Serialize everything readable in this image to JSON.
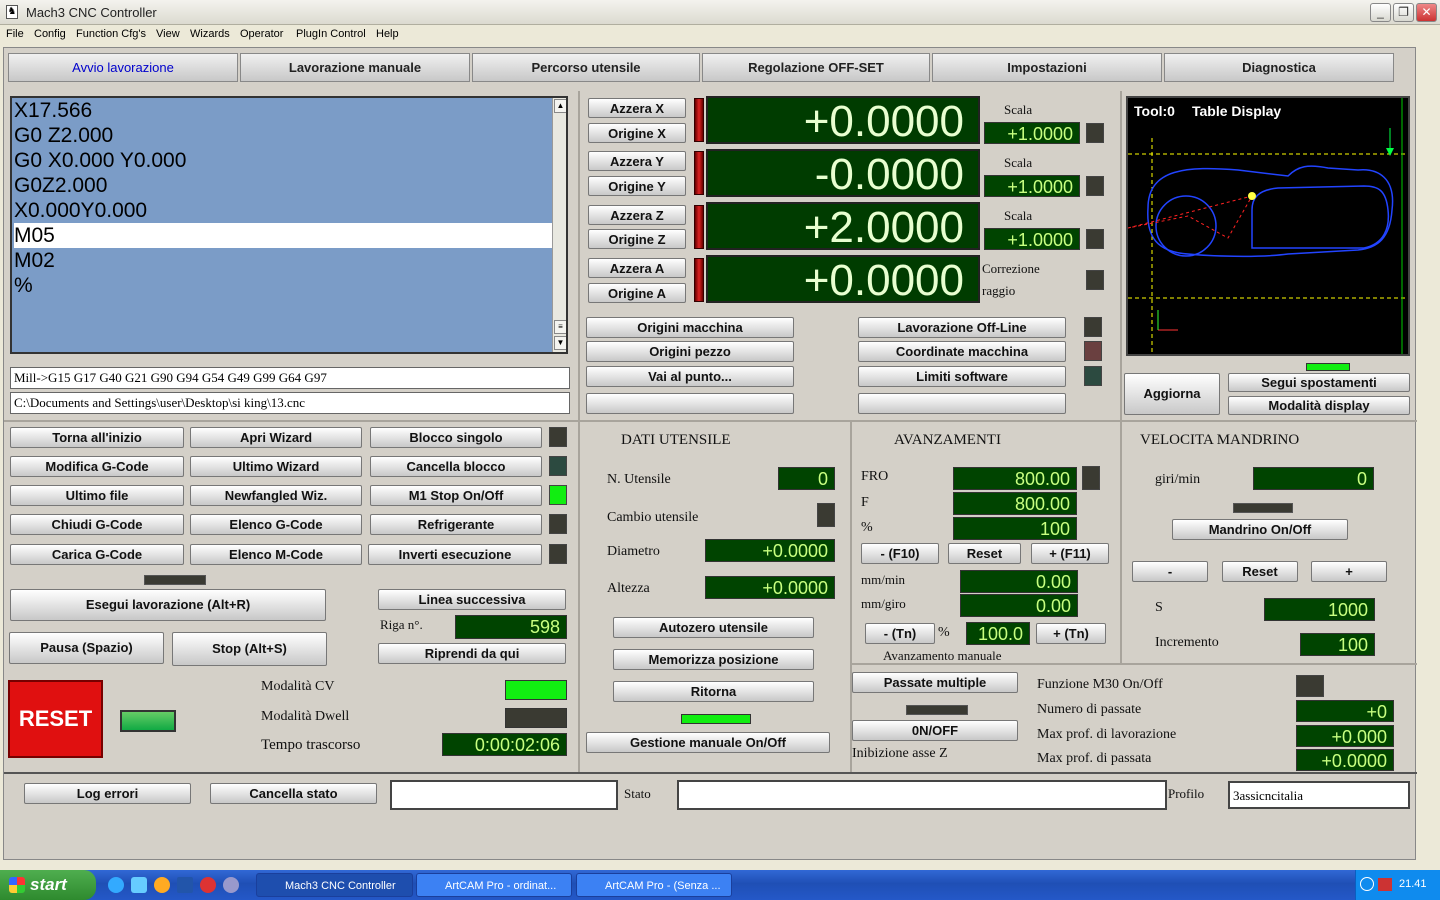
{
  "window": {
    "title": "Mach3 CNC Controller"
  },
  "menu": [
    "File",
    "Config",
    "Function Cfg's",
    "View",
    "Wizards",
    "Operator",
    "PlugIn Control",
    "Help"
  ],
  "tabs": [
    "Avvio lavorazione",
    "Lavorazione manuale",
    "Percorso utensile",
    "Regolazione OFF-SET",
    "Impostazioni",
    "Diagnostica"
  ],
  "gcode": {
    "lines": [
      "X17.566",
      "G0   Z2.000",
      "G0 X0.000 Y0.000",
      "G0Z2.000",
      "X0.000Y0.000",
      "M05",
      "M02",
      "%"
    ]
  },
  "modal_line": "Mill->G15  G17 G40 G21 G90 G94 G54 G49 G99 G64 G97",
  "file_path": "C:\\Documents and Settings\\user\\Desktop\\si king\\13.cnc",
  "axes": [
    {
      "zero": "Azzera X",
      "ref": "Origine X",
      "value": "+0.0000",
      "scale_label": "Scala",
      "scale": "+1.0000"
    },
    {
      "zero": "Azzera Y",
      "ref": "Origine Y",
      "value": "-0.0000",
      "scale_label": "Scala",
      "scale": "+1.0000"
    },
    {
      "zero": "Azzera Z",
      "ref": "Origine Z",
      "value": "+2.0000",
      "scale_label": "Scala",
      "scale": "+1.0000"
    },
    {
      "zero": "Azzera A",
      "ref": "Origine A",
      "value": "+0.0000"
    }
  ],
  "radius_comp": {
    "line1": "Correzione",
    "line2": "raggio"
  },
  "coord_buttons": {
    "machine_origins": "Origini macchina",
    "part_origins": "Origini pezzo",
    "goto": "Vai al punto...",
    "offline": "Lavorazione Off-Line",
    "machine_coords": "Coordinate macchina",
    "soft_limits": "Limiti software"
  },
  "toolpath": {
    "tool": "Tool:0",
    "title": "Table Display",
    "refresh": "Aggiorna",
    "follow": "Segui spostamenti",
    "display_mode": "Modalità display"
  },
  "left_buttons": [
    [
      "Torna all'inizio",
      "Apri Wizard",
      "Blocco singolo"
    ],
    [
      "Modifica G-Code",
      "Ultimo Wizard",
      "Cancella blocco"
    ],
    [
      "Ultimo file",
      "Newfangled Wiz.",
      "M1 Stop On/Off"
    ],
    [
      "Chiudi G-Code",
      "Elenco G-Code",
      "Refrigerante"
    ],
    [
      "Carica G-Code",
      "Elenco M-Code",
      "Inverti esecuzione"
    ]
  ],
  "cycle": {
    "start": "Esegui lavorazione (Alt+R)",
    "pause": "Pausa (Spazio)",
    "stop": "Stop (Alt+S)",
    "next_line": "Linea successiva",
    "line_no_label": "Riga n°.",
    "line_no": "598",
    "run_from_here": "Riprendi da qui",
    "reset": "RESET",
    "cv_mode": "Modalità CV",
    "dwell_mode": "Modalità Dwell",
    "elapsed_label": "Tempo trascorso",
    "elapsed": "0:00:02:06"
  },
  "tool": {
    "title": "DATI UTENSILE",
    "number_label": "N. Utensile",
    "number": "0",
    "change_label": "Cambio utensile",
    "diameter_label": "Diametro",
    "diameter": "+0.0000",
    "height_label": "Altezza",
    "height": "+0.0000",
    "autozero": "Autozero utensile",
    "remember": "Memorizza posizione",
    "return": "Ritorna",
    "manual": "Gestione manuale On/Off"
  },
  "feed": {
    "title": "AVANZAMENTI",
    "fro_label": "FRO",
    "fro": "800.00",
    "f_label": "F",
    "f": "800.00",
    "pct_label": "%",
    "pct": "100",
    "minus": "- (F10)",
    "reset": "Reset",
    "plus": "+ (F11)",
    "mmmin_label": "mm/min",
    "mmmin": "0.00",
    "mmrev_label": "mm/giro",
    "mmrev": "0.00",
    "tn_minus": "- (Tn)",
    "tn_pct_label": "%",
    "tn_value": "100.0",
    "tn_plus": "+ (Tn)",
    "manual_label": "Avanzamento manuale"
  },
  "spindle": {
    "title": "VELOCITA MANDRINO",
    "rpm_label": "giri/min",
    "rpm": "0",
    "toggle": "Mandrino On/Off",
    "minus": "-",
    "reset": "Reset",
    "plus": "+",
    "s_label": "S",
    "s": "1000",
    "inc_label": "Incremento",
    "inc": "100"
  },
  "multipass": {
    "button": "Passate multiple",
    "onoff": "0N/OFF",
    "z_inhibit": "Inibizione asse Z",
    "m30_label": "Funzione M30 On/Off",
    "passes_label": "Numero di passate",
    "passes": "+0",
    "max_depth_label": "Max prof.  di lavorazione",
    "max_depth": "+0.000",
    "max_pass_label": "Max prof.  di passata",
    "max_pass": "+0.0000"
  },
  "status": {
    "log": "Log errori",
    "clear": "Cancella stato",
    "state_label": "Stato",
    "profile_label": "Profilo",
    "profile": "3assicncitalia"
  },
  "taskbar": {
    "start": "start",
    "tasks": [
      "Mach3 CNC Controller",
      "ArtCAM Pro - ordinat...",
      "ArtCAM Pro - (Senza ..."
    ],
    "clock": "21.41"
  }
}
